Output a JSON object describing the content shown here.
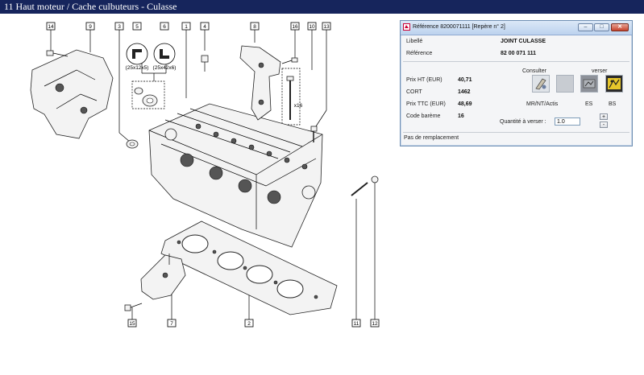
{
  "window": {
    "title": "11 Haut moteur / Cache culbuteurs - Culasse"
  },
  "diagram": {
    "part_tags": [
      "14",
      "9",
      "3",
      "5",
      "6",
      "1",
      "4",
      "8",
      "16",
      "10",
      "13",
      "11",
      "12",
      "15",
      "7",
      "2"
    ],
    "seal_labels": {
      "seal_5": "(25x12x5)",
      "seal_6": "(25x42x6)",
      "screw_qty": "x16"
    }
  },
  "popup": {
    "title": "Référence 8200071111 [Repère n° 2]",
    "controls": {
      "minimize": "–",
      "maximize": "□",
      "close": "✕"
    },
    "libelle_label": "Libellé",
    "libelle_value": "JOINT CULASSE",
    "reference_label": "Référence",
    "reference_value": "82 00 071 111",
    "prix_ht_label": "Prix HT (EUR)",
    "prix_ht_value": "40,71",
    "cort_label": "CORT",
    "cort_value": "1462",
    "prix_ttc_label": "Prix TTC (EUR)",
    "prix_ttc_value": "48,69",
    "code_bareme_label": "Code barème",
    "code_bareme_value": "16",
    "consulter_label": "Consulter",
    "verser_label": "verser",
    "mr_label": "MR/NT/Actis",
    "es_label": "ES",
    "bs_label": "BS",
    "quantite_label": "Quantité à verser :",
    "quantite_value": "1.0",
    "spin_up": "+",
    "spin_down": "-",
    "status": "Pas de remplacement",
    "icons": [
      "consult-icon",
      "blank-square",
      "es-icon",
      "bs-icon"
    ],
    "colors": {
      "titlebar": "#16255c",
      "popup_title": "#c7dbf2",
      "close": "#c6422c"
    }
  }
}
